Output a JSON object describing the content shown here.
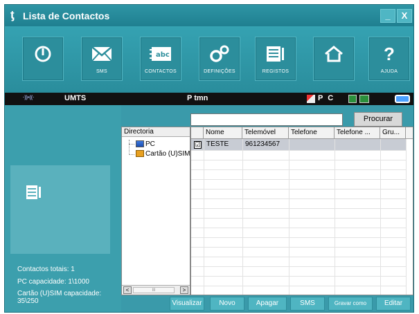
{
  "window": {
    "logo": "ƫ",
    "title": "Lista de Contactos",
    "minimize": "_",
    "close": "X"
  },
  "toolbar": {
    "items": [
      {
        "id": "power",
        "icon": "power-icon",
        "label": ""
      },
      {
        "id": "sms",
        "icon": "envelope-icon",
        "label": "SMS"
      },
      {
        "id": "contacts",
        "icon": "contacts-card-icon",
        "label": "CONTACTOS",
        "icon_text": "abc"
      },
      {
        "id": "settings",
        "icon": "gears-icon",
        "label": "DEFINIÇÕES"
      },
      {
        "id": "logs",
        "icon": "logs-icon",
        "label": "REGISTOS"
      },
      {
        "id": "home",
        "icon": "home-icon",
        "label": ""
      },
      {
        "id": "help",
        "icon": "question-icon",
        "label": "AJUDA",
        "icon_text": "?"
      }
    ]
  },
  "status": {
    "signal": "·))•((·",
    "network": "UMTS",
    "operator": "P tmn",
    "pc": "P C"
  },
  "info": {
    "total": "Contactos totais: 1",
    "pc_capacity": "PC capacidade: 1\\1000",
    "sim_capacity": "Cartão (U)SIM capacidade: 35\\250"
  },
  "search": {
    "value": "",
    "placeholder": "",
    "button": "Procurar"
  },
  "directory": {
    "header": "Directoria",
    "items": [
      "PC",
      "Cartão (U)SIM"
    ],
    "scroll_left": "<",
    "scroll_right": ">",
    "scroll_thumb": "III"
  },
  "table": {
    "columns": [
      "",
      "Nome",
      "Telemóvel",
      "Telefone",
      "Telefone ...",
      "Gru..."
    ],
    "rows": [
      {
        "checked": "☑",
        "nome": "TESTE",
        "telemovel": "961234567",
        "telefone": "",
        "telefone2": "",
        "grupo": ""
      }
    ]
  },
  "actions": {
    "view": "Visualizar",
    "new": "Novo",
    "delete": "Apagar",
    "sms": "SMS",
    "save_as": "Gravar como",
    "edit": "Editar"
  },
  "colors": {
    "background": "#3a9aaa",
    "status_bar": "#111111",
    "button": "#4fb5c2",
    "selected_row": "#c8ccd4"
  }
}
